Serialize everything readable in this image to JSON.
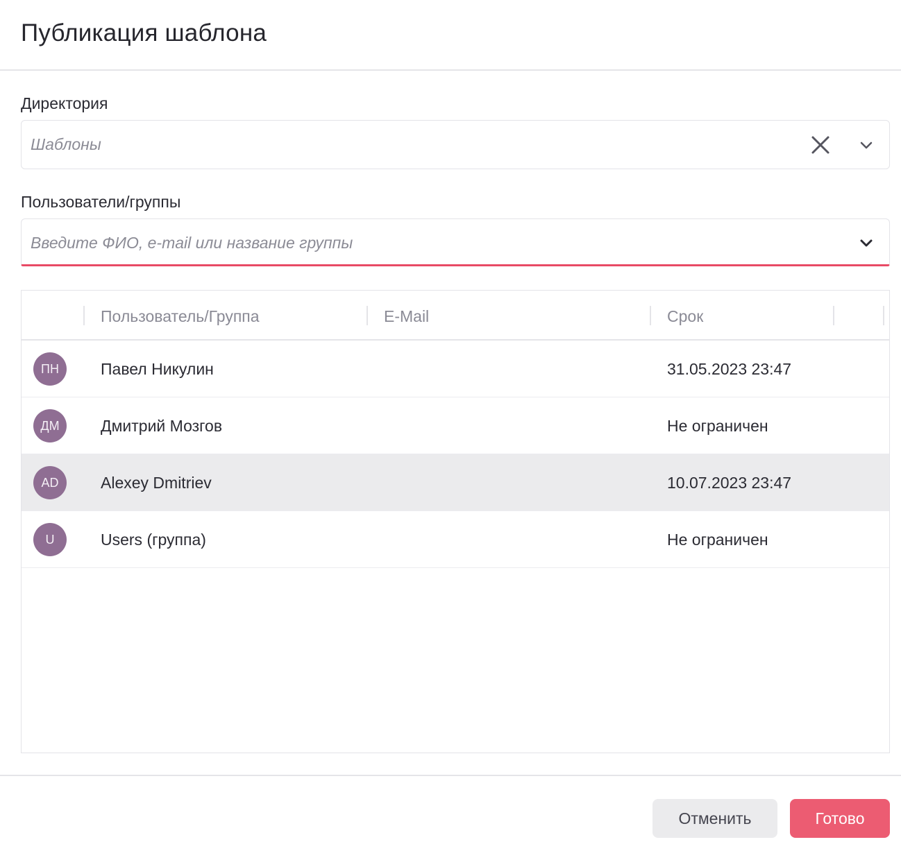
{
  "dialog": {
    "title": "Публикация шаблона"
  },
  "directory": {
    "label": "Директория",
    "value": "Шаблоны",
    "clear_icon": "close-icon",
    "dropdown_icon": "chevron-down-icon"
  },
  "users": {
    "label": "Пользователи/группы",
    "placeholder": "Введите ФИО, e-mail или название группы",
    "dropdown_icon": "chevron-down-icon",
    "error_color": "#e84a65"
  },
  "table": {
    "columns": [
      "Пользователь/Группа",
      "E-Mail",
      "Срок"
    ],
    "rows": [
      {
        "initials": "ПН",
        "name": "Павел Никулин",
        "email": "",
        "term": "31.05.2023 23:47"
      },
      {
        "initials": "ДМ",
        "name": "Дмитрий Мозгов",
        "email": "",
        "term": "Не ограничен"
      },
      {
        "initials": "AD",
        "name": "Alexey Dmitriev",
        "email": "",
        "term": "10.07.2023 23:47"
      },
      {
        "initials": "U",
        "name": "Users (группа)",
        "email": "",
        "term": "Не ограничен"
      }
    ]
  },
  "footer": {
    "cancel_label": "Отменить",
    "done_label": "Готово"
  },
  "colors": {
    "accent": "#ec5c72",
    "avatar": "#8f6e93",
    "hover_row": "#ebebed"
  }
}
